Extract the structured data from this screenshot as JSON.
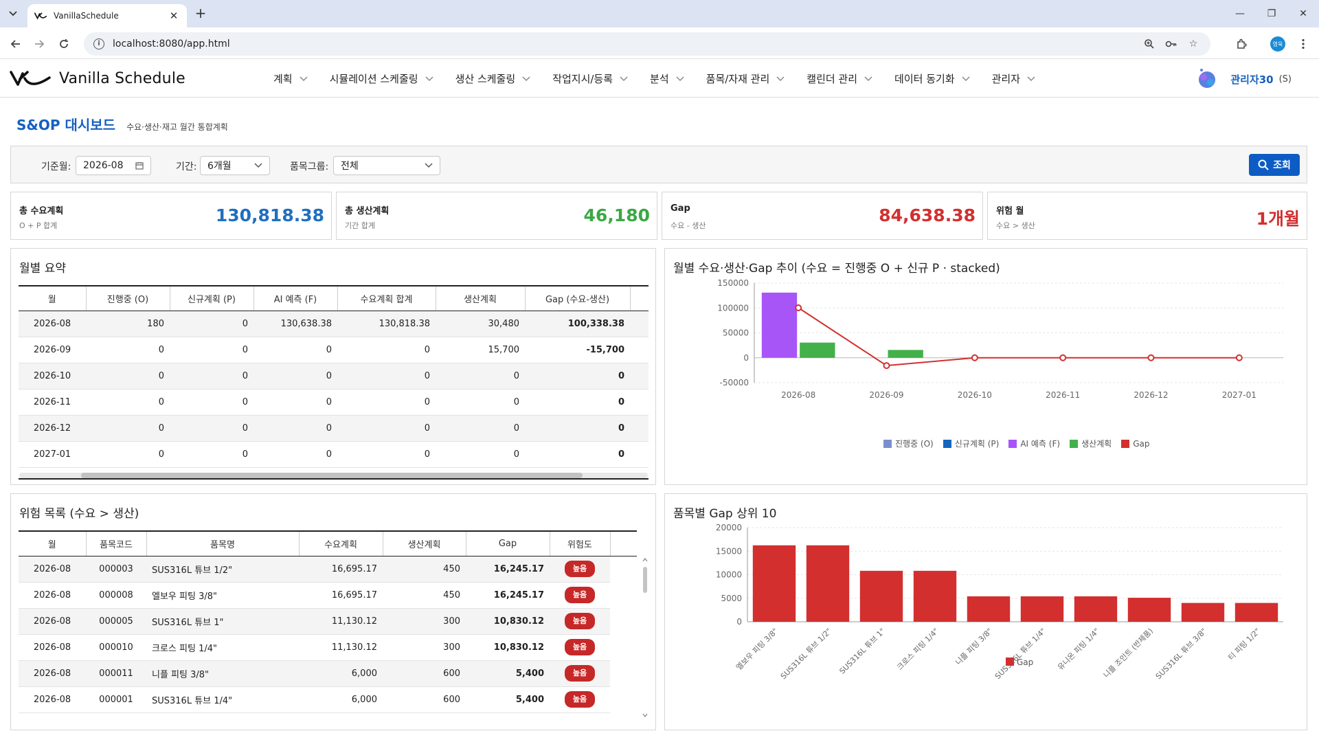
{
  "browser": {
    "tab_title": "VanillaSchedule",
    "url": "localhost:8080/app.html",
    "profile_initial": "영욱"
  },
  "app": {
    "brand": "Vanilla Schedule",
    "menu": [
      "계획",
      "시뮬레이션 스케줄링",
      "생산 스케줄링",
      "작업지시/등록",
      "분석",
      "품목/자재 관리",
      "캘린더 관리",
      "데이터 동기화",
      "관리자"
    ],
    "user_name": "관리자30",
    "user_role": "(S)"
  },
  "page": {
    "title": "S&OP 대시보드",
    "subtitle": "수요·생산·재고 월간 통합계획"
  },
  "filters": {
    "base_month_label": "기준월:",
    "base_month_value": "2026-08",
    "period_label": "기간:",
    "period_value": "6개월",
    "group_label": "품목그룹:",
    "group_value": "전체",
    "search_label": "조회"
  },
  "kpis": [
    {
      "title": "총 수요계획",
      "sub": "O + P 합계",
      "value": "130,818.38",
      "color": "#1f6fbf"
    },
    {
      "title": "총 생산계획",
      "sub": "기간 합계",
      "value": "46,180",
      "color": "#3aa845"
    },
    {
      "title": "Gap",
      "sub": "수요 - 생산",
      "value": "84,638.38",
      "color": "#d32f2f"
    },
    {
      "title": "위험 월",
      "sub": "수요 > 생산",
      "value": "1개월",
      "color": "#d32f2f"
    }
  ],
  "monthly": {
    "title": "월별 요약",
    "headers": [
      "월",
      "진행중 (O)",
      "신규계획 (P)",
      "AI 예측 (F)",
      "수요계획 합계",
      "생산계획",
      "Gap (수요-생산)"
    ],
    "rows": [
      [
        "2026-08",
        "180",
        "0",
        "130,638.38",
        "130,818.38",
        "30,480",
        "100,338.38"
      ],
      [
        "2026-09",
        "0",
        "0",
        "0",
        "0",
        "15,700",
        "-15,700"
      ],
      [
        "2026-10",
        "0",
        "0",
        "0",
        "0",
        "0",
        "0"
      ],
      [
        "2026-11",
        "0",
        "0",
        "0",
        "0",
        "0",
        "0"
      ],
      [
        "2026-12",
        "0",
        "0",
        "0",
        "0",
        "0",
        "0"
      ],
      [
        "2027-01",
        "0",
        "0",
        "0",
        "0",
        "0",
        "0"
      ]
    ]
  },
  "risk": {
    "title": "위험 목록 (수요 > 생산)",
    "headers": [
      "월",
      "품목코드",
      "품목명",
      "수요계획",
      "생산계획",
      "Gap",
      "위험도"
    ],
    "rows": [
      [
        "2026-08",
        "000003",
        "SUS316L 튜브 1/2\"",
        "16,695.17",
        "450",
        "16,245.17",
        "높음"
      ],
      [
        "2026-08",
        "000008",
        "엘보우 피팅 3/8\"",
        "16,695.17",
        "450",
        "16,245.17",
        "높음"
      ],
      [
        "2026-08",
        "000005",
        "SUS316L 튜브 1\"",
        "11,130.12",
        "300",
        "10,830.12",
        "높음"
      ],
      [
        "2026-08",
        "000010",
        "크로스 피팅 1/4\"",
        "11,130.12",
        "300",
        "10,830.12",
        "높음"
      ],
      [
        "2026-08",
        "000011",
        "니플 피팅 3/8\"",
        "6,000",
        "600",
        "5,400",
        "높음"
      ],
      [
        "2026-08",
        "000001",
        "SUS316L 튜브 1/4\"",
        "6,000",
        "600",
        "5,400",
        "높음"
      ]
    ]
  },
  "chart_data": [
    {
      "type": "bar",
      "title": "월별 수요·생산·Gap 추이 (수요 = 진행중 O + 신규 P · stacked)",
      "categories": [
        "2026-08",
        "2026-09",
        "2026-10",
        "2026-11",
        "2026-12",
        "2027-01"
      ],
      "ylim": [
        -50000,
        150000
      ],
      "yticks": [
        "150000",
        "100000",
        "50000",
        "0",
        "-50000"
      ],
      "series": [
        {
          "name": "진행중 (O)",
          "color": "#7b8fcf",
          "kind": "stacked-bar",
          "values": [
            180,
            0,
            0,
            0,
            0,
            0
          ]
        },
        {
          "name": "신규계획 (P)",
          "color": "#1565c0",
          "kind": "stacked-bar",
          "values": [
            0,
            0,
            0,
            0,
            0,
            0
          ]
        },
        {
          "name": "AI 예측 (F)",
          "color": "#a855f7",
          "kind": "stacked-bar",
          "values": [
            130638.38,
            0,
            0,
            0,
            0,
            0
          ]
        },
        {
          "name": "생산계획",
          "color": "#43b04a",
          "kind": "bar",
          "values": [
            30480,
            15700,
            0,
            0,
            0,
            0
          ]
        },
        {
          "name": "Gap",
          "color": "#d32f2f",
          "kind": "line",
          "values": [
            100338.38,
            -15700,
            0,
            0,
            0,
            0
          ]
        }
      ],
      "grid": true,
      "legend": "bottom"
    },
    {
      "type": "bar",
      "title": "품목별 Gap 상위 10",
      "categories": [
        "엘보우 피팅 3/8\"",
        "SUS316L 튜브 1/2\"",
        "SUS316L 튜브 1\"",
        "크로스 피팅 1/4\"",
        "니플 피팅 3/8\"",
        "SUS316L 튜브 1/4\"",
        "유니온 피팅 1/4\"",
        "니플 조인트 (반제품)",
        "SUS316L 튜브 3/8\"",
        "티 피팅 1/2\""
      ],
      "ylim": [
        0,
        20000
      ],
      "yticks": [
        "20000",
        "15000",
        "10000",
        "5000",
        "0"
      ],
      "series": [
        {
          "name": "Gap",
          "color": "#d32f2f",
          "values": [
            16245.17,
            16245.17,
            10830.12,
            10830.12,
            5400,
            5400,
            5400,
            5100,
            4000,
            4000
          ]
        }
      ],
      "grid": true,
      "legend": "bottom"
    }
  ]
}
